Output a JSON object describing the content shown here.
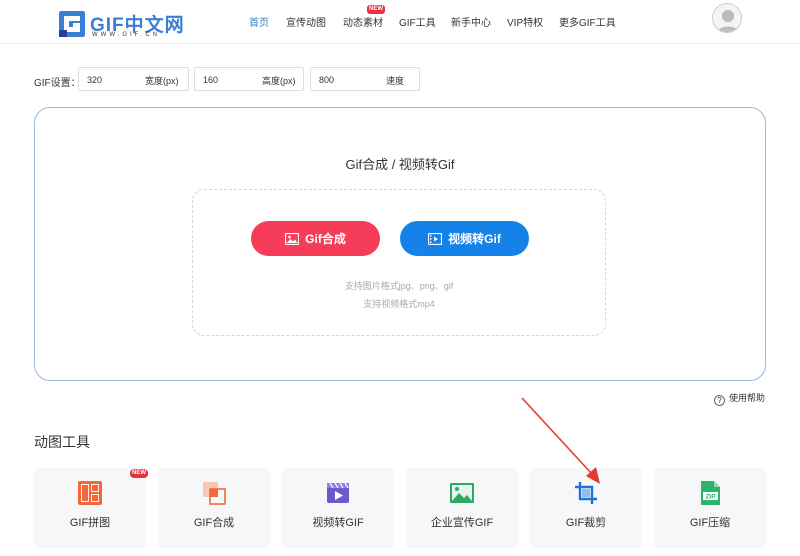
{
  "header": {
    "logo_text": "GIF中文网",
    "logo_url": "WWW.GIF.CN",
    "nav": [
      {
        "label": "首页",
        "active": true
      },
      {
        "label": "宣传动图"
      },
      {
        "label": "动态素材",
        "badge": "NEW"
      },
      {
        "label": "GIF工具"
      },
      {
        "label": "新手中心"
      },
      {
        "label": "VIP特权"
      },
      {
        "label": "更多GIF工具"
      }
    ]
  },
  "settings": {
    "label": "GIF设置：",
    "width": {
      "value": "320",
      "unit": "宽度(px)"
    },
    "height": {
      "value": "160",
      "unit": "高度(px)"
    },
    "speed": {
      "value": "800",
      "unit": "速度"
    }
  },
  "panel": {
    "title": "Gif合成 / 视频转Gif",
    "btn_compose": "Gif合成",
    "btn_video": "视频转Gif",
    "hint_images": "支持图片格式jpg、png、gif",
    "hint_video": "支持视频格式mp4"
  },
  "help_label": "使用帮助",
  "tools_section": {
    "title": "动图工具",
    "items": [
      {
        "label": "GIF拼图",
        "icon": "collage-icon",
        "badge": "NEW"
      },
      {
        "label": "GIF合成",
        "icon": "merge-icon"
      },
      {
        "label": "视频转GIF",
        "icon": "video-icon"
      },
      {
        "label": "企业宣传GIF",
        "icon": "image-icon"
      },
      {
        "label": "GIF裁剪",
        "icon": "crop-icon"
      },
      {
        "label": "GIF压缩",
        "icon": "zip-icon"
      }
    ]
  },
  "colors": {
    "accent_blue": "#1482e8",
    "accent_red": "#f53d5a",
    "logo_blue": "#3a7fd5",
    "annotation_red": "#e53935"
  }
}
